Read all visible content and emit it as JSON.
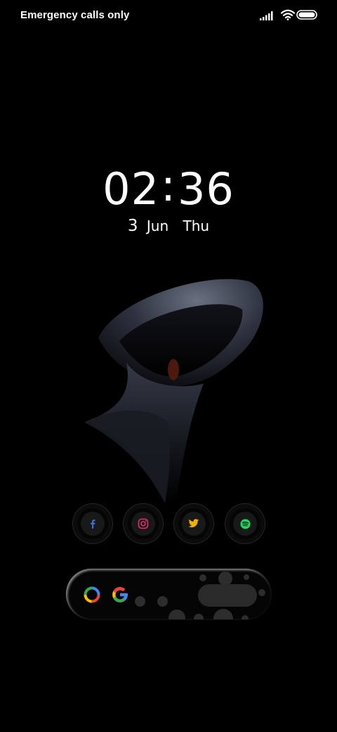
{
  "status_bar": {
    "carrier_text": "Emergency calls only",
    "icons": [
      "signal-icon",
      "wifi-icon",
      "battery-icon"
    ]
  },
  "clock": {
    "time": "02:36",
    "hours": "02",
    "minutes": "36"
  },
  "date": {
    "day": "3",
    "month": "Jun",
    "weekday": "Thu"
  },
  "shortcuts": [
    {
      "name": "facebook",
      "icon": "facebook-icon",
      "color": "#3b6fd4"
    },
    {
      "name": "instagram",
      "icon": "instagram-icon",
      "color": "#e1306c"
    },
    {
      "name": "twitter",
      "icon": "twitter-icon",
      "color": "#f2b300"
    },
    {
      "name": "spotify",
      "icon": "spotify-icon",
      "color": "#1ed760"
    }
  ],
  "search_widget": {
    "icons": [
      "google-lens-icon",
      "google-icon"
    ]
  },
  "colors": {
    "background": "#000000",
    "text": "#ffffff"
  }
}
